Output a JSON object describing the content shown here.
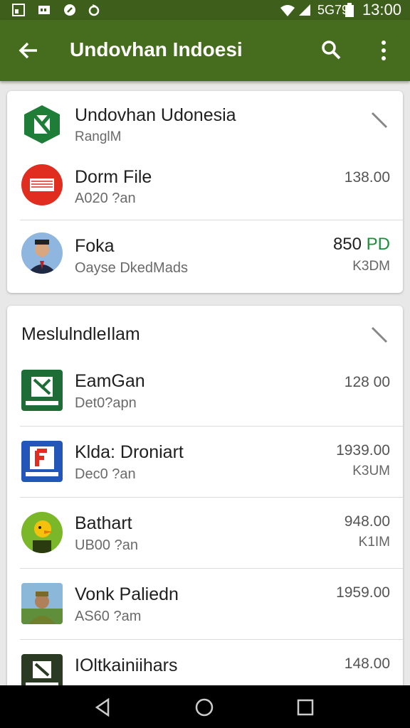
{
  "status_bar": {
    "indicator_text": "5G79",
    "time": "13:00",
    "icons": [
      "screenshot-icon",
      "sd-card-icon",
      "data-saver-icon",
      "sync-icon",
      "wifi-icon",
      "signal-icon",
      "battery-icon"
    ]
  },
  "app_bar": {
    "title": "Undovhan Indoesi",
    "icons": [
      "back-arrow-icon",
      "search-icon",
      "more-vert-icon"
    ],
    "color": "#466d1d"
  },
  "card1": {
    "header": {
      "name": "Undovhan Udonesia",
      "sub": "RanglM"
    },
    "items": [
      {
        "name": "Dorm File",
        "sub": "A020 ?an",
        "amount": "138.00",
        "amount2": ""
      },
      {
        "name": "Foka",
        "sub": "Oayse DkedMads",
        "amount": "850",
        "amount_suffix": "PD",
        "amount2": "K3DM"
      }
    ]
  },
  "card2": {
    "title": "MeslulndleIlam",
    "items": [
      {
        "name": "EamGan",
        "sub": "Det0?apn",
        "amount": "128 00",
        "amount2": ""
      },
      {
        "name": "Klda: Droniart",
        "sub": "Dec0 ?an",
        "amount": "1939.00",
        "amount2": "K3UM"
      },
      {
        "name": "Bathart",
        "sub": "UB00 ?an",
        "amount": "948.00",
        "amount2": "K1IM"
      },
      {
        "name": "Vonk Paliedn",
        "sub": "AS60 ?am",
        "amount": "1959.00",
        "amount2": ""
      },
      {
        "name": "IOltkainiihars",
        "sub": "",
        "amount": "148.00",
        "amount2": ""
      }
    ]
  },
  "nav_bar": {
    "icons": [
      "back-triangle-icon",
      "home-circle-icon",
      "recents-square-icon"
    ]
  },
  "colors": {
    "accent": "#466d1d",
    "positive": "#1a8f3a"
  }
}
